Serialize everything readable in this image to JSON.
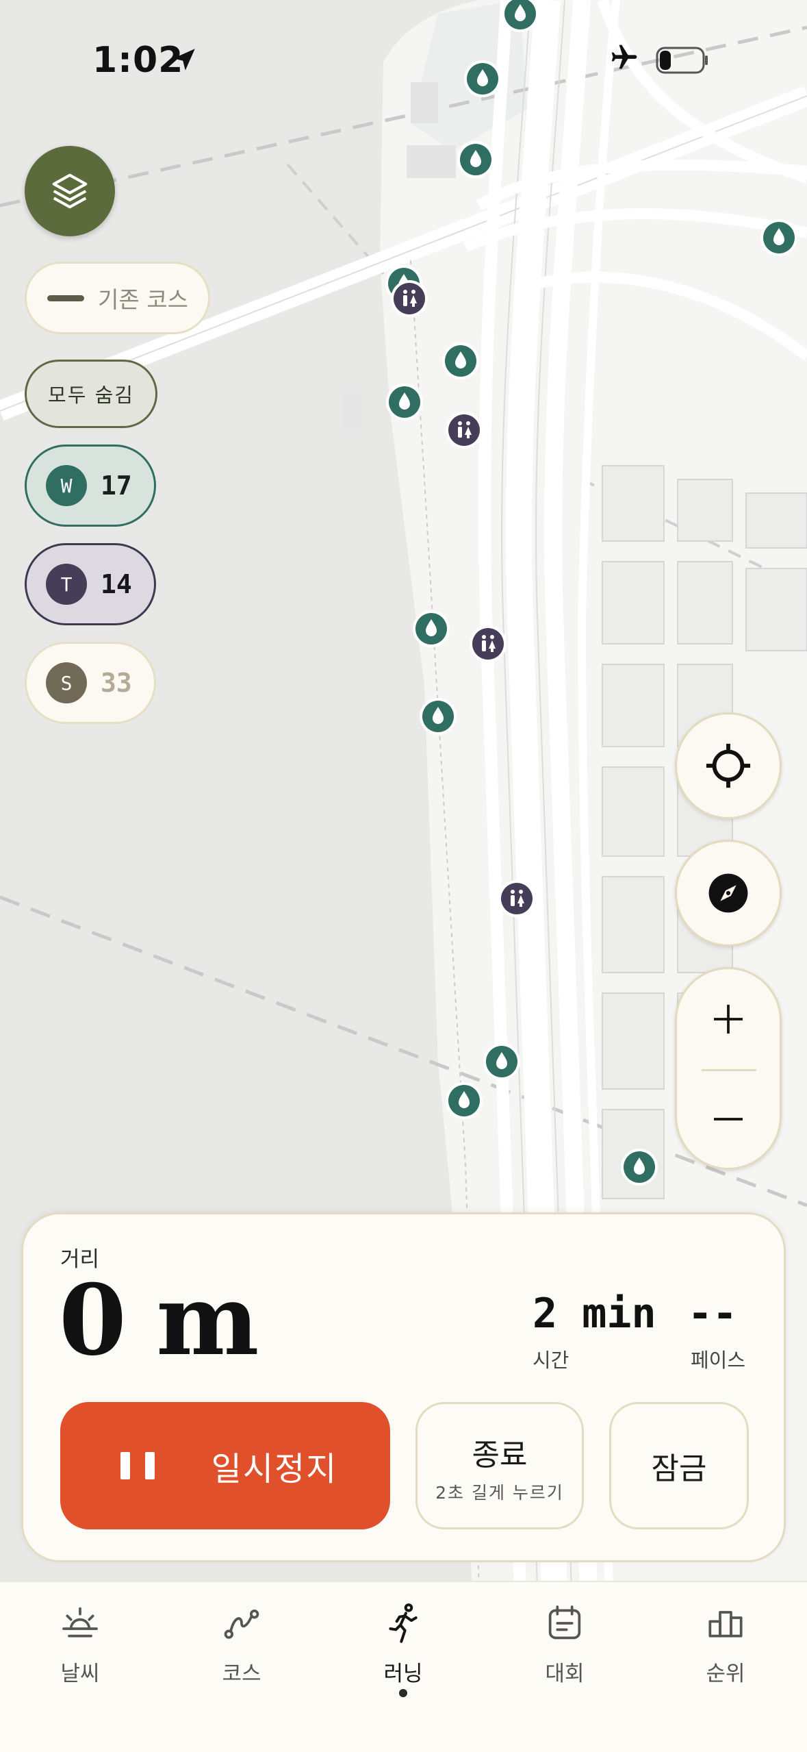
{
  "status_bar": {
    "time": "1:02"
  },
  "map": {
    "course_chip": "기존 코스",
    "hide_all": "모두 숨김",
    "filters": [
      {
        "letter": "W",
        "count": "17"
      },
      {
        "letter": "T",
        "count": "14"
      },
      {
        "letter": "S",
        "count": "33"
      }
    ],
    "colors": {
      "water": "#2f6e61",
      "toilet": "#463d58",
      "layers": "#5c6b3c"
    }
  },
  "run_panel": {
    "distance_label": "거리",
    "distance_value": "0 m",
    "time_value": "2 min",
    "time_label": "시간",
    "pace_value": "--",
    "pace_label": "페이스",
    "pause_label": "일시정지",
    "end_label": "종료",
    "end_hint": "2초 길게 누르기",
    "lock_label": "잠금",
    "accent": "#e0502b"
  },
  "tabs": [
    {
      "label": "날씨",
      "icon": "sun-horizon-icon",
      "active": false
    },
    {
      "label": "코스",
      "icon": "route-icon",
      "active": false
    },
    {
      "label": "러닝",
      "icon": "runner-icon",
      "active": true
    },
    {
      "label": "대회",
      "icon": "calendar-icon",
      "active": false
    },
    {
      "label": "순위",
      "icon": "podium-icon",
      "active": false
    }
  ]
}
